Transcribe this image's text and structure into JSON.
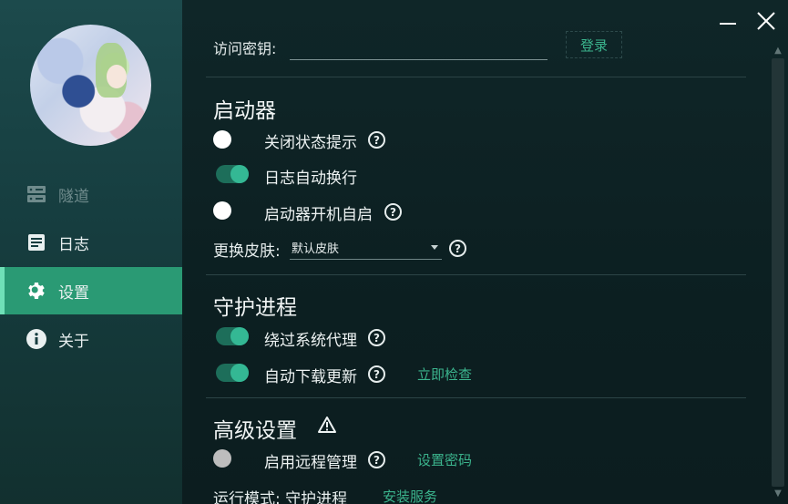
{
  "nav": {
    "items": [
      {
        "label": "隧道",
        "icon": "server-icon",
        "state": "disabled"
      },
      {
        "label": "日志",
        "icon": "log-icon",
        "state": "normal"
      },
      {
        "label": "设置",
        "icon": "gear-icon",
        "state": "active"
      },
      {
        "label": "关于",
        "icon": "info-icon",
        "state": "normal"
      }
    ]
  },
  "window_controls": {
    "minimize": "minimize-icon",
    "close": "close-icon"
  },
  "access": {
    "label": "访问密钥:",
    "value": "",
    "login_label": "登录"
  },
  "launcher": {
    "title": "启动器",
    "options": [
      {
        "label": "关闭状态提示",
        "enabled": false,
        "help": "?"
      },
      {
        "label": "日志自动换行",
        "enabled": true
      },
      {
        "label": "启动器开机自启",
        "enabled": false,
        "help": "?"
      }
    ],
    "skin": {
      "label": "更换皮肤:",
      "value": "默认皮肤",
      "help": "?"
    }
  },
  "daemon": {
    "title": "守护进程",
    "options": [
      {
        "label": "绕过系统代理",
        "enabled": true,
        "help": "?"
      },
      {
        "label": "自动下载更新",
        "enabled": true,
        "help": "?",
        "action": "立即检查"
      }
    ]
  },
  "advanced": {
    "title": "高级设置",
    "warning_icon": "warning-icon",
    "options": [
      {
        "label": "启用远程管理",
        "enabled": false,
        "disabled": true,
        "help": "?",
        "action": "设置密码"
      }
    ],
    "run_mode": {
      "label": "运行模式: 守护进程",
      "action": "安装服务"
    }
  },
  "colors": {
    "accent": "#2a9a74",
    "link": "#3bb48d",
    "sidebar": "#1c4a4c",
    "background": "#0d2224"
  }
}
